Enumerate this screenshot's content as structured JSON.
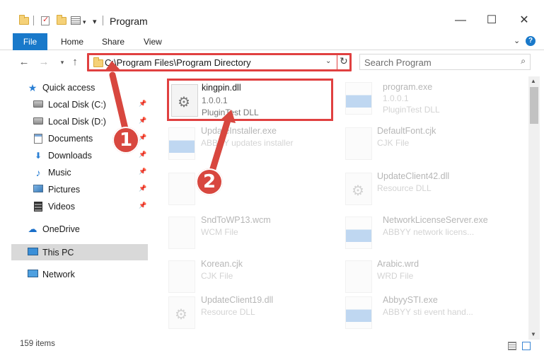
{
  "window": {
    "title": "Program",
    "minimize_glyph": "—",
    "maximize_glyph": "☐",
    "close_glyph": "✕"
  },
  "ribbon": {
    "tabs": [
      "File",
      "Home",
      "Share",
      "View"
    ]
  },
  "address": {
    "path": "C:\\Program Files\\Program Directory"
  },
  "search": {
    "placeholder": "Search Program"
  },
  "sidebar": {
    "items": [
      {
        "label": "Quick access",
        "icon": "star-icon",
        "pinned": false
      },
      {
        "label": "Local Disk (C:)",
        "icon": "disk-icon",
        "pinned": true
      },
      {
        "label": "Local Disk (D:)",
        "icon": "disk-icon",
        "pinned": true
      },
      {
        "label": "Documents",
        "icon": "documents-icon",
        "pinned": true
      },
      {
        "label": "Downloads",
        "icon": "download-icon",
        "pinned": true
      },
      {
        "label": "Music",
        "icon": "music-icon",
        "pinned": true
      },
      {
        "label": "Pictures",
        "icon": "pictures-icon",
        "pinned": true
      },
      {
        "label": "Videos",
        "icon": "videos-icon",
        "pinned": true
      },
      {
        "label": "OneDrive",
        "icon": "cloud-icon",
        "pinned": false
      },
      {
        "label": "This PC",
        "icon": "computer-icon",
        "pinned": false,
        "selected": true
      },
      {
        "label": "Network",
        "icon": "network-icon",
        "pinned": false
      }
    ]
  },
  "files": [
    {
      "name": "kingpin.dll",
      "line2": "1.0.0.1",
      "line3": "PluginTest DLL",
      "highlighted": true
    },
    {
      "name": "program.exe",
      "line2": "1.0.0.1",
      "line3": "PluginTest DLL"
    },
    {
      "name": "UpdateInstaller.exe",
      "line2": "ABBYY updates installer",
      "line3": ""
    },
    {
      "name": "DefaultFont.cjk",
      "line2": "CJK File",
      "line3": ""
    },
    {
      "name": "",
      "line2": "",
      "line3": ""
    },
    {
      "name": "UpdateClient42.dll",
      "line2": "Resource DLL",
      "line3": ""
    },
    {
      "name": "SndToWP13.wcm",
      "line2": "WCM File",
      "line3": ""
    },
    {
      "name": "NetworkLicenseServer.exe",
      "line2": "ABBYY network licens...",
      "line3": ""
    },
    {
      "name": "Korean.cjk",
      "line2": "CJK File",
      "line3": ""
    },
    {
      "name": "Arabic.wrd",
      "line2": "WRD File",
      "line3": ""
    },
    {
      "name": "UpdateClient19.dll",
      "line2": "Resource DLL",
      "line3": ""
    },
    {
      "name": "AbbyySTI.exe",
      "line2": "ABBYY sti event hand...",
      "line3": ""
    }
  ],
  "status": {
    "item_count": "159 items"
  },
  "annotations": {
    "marker1": "1",
    "marker2": "2",
    "color": "#d8473f"
  },
  "colors": {
    "accent": "#1979ca",
    "highlight_border": "#e04040"
  }
}
